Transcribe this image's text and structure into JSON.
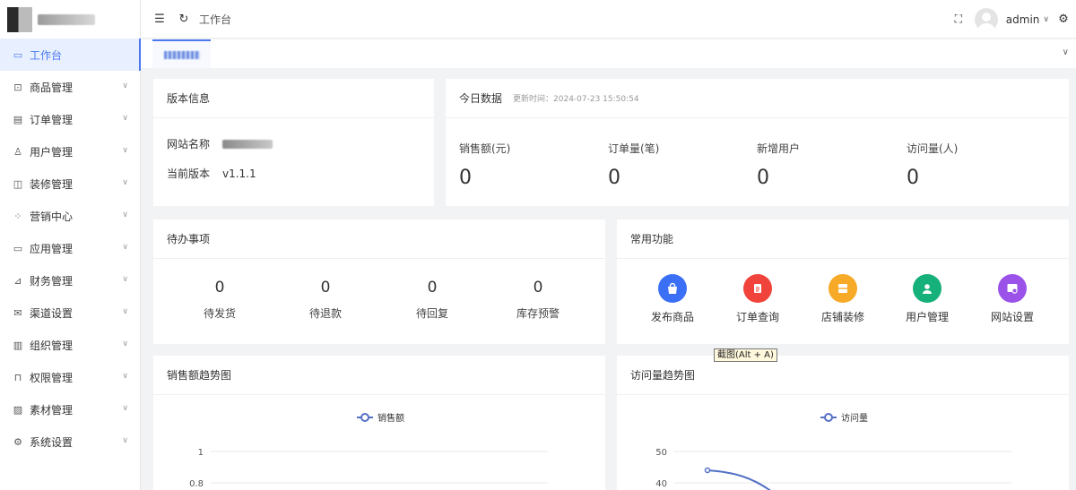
{
  "sidebar": {
    "items": [
      {
        "label": "工作台",
        "icon": "monitor-icon",
        "active": true
      },
      {
        "label": "商品管理",
        "icon": "shopping-bag-icon"
      },
      {
        "label": "订单管理",
        "icon": "document-icon"
      },
      {
        "label": "用户管理",
        "icon": "user-icon"
      },
      {
        "label": "装修管理",
        "icon": "palette-icon"
      },
      {
        "label": "营销中心",
        "icon": "apps-icon"
      },
      {
        "label": "应用管理",
        "icon": "card-icon"
      },
      {
        "label": "财务管理",
        "icon": "chart-icon"
      },
      {
        "label": "渠道设置",
        "icon": "mail-icon"
      },
      {
        "label": "组织管理",
        "icon": "building-icon"
      },
      {
        "label": "权限管理",
        "icon": "lock-icon"
      },
      {
        "label": "素材管理",
        "icon": "image-icon"
      },
      {
        "label": "系统设置",
        "icon": "gear-icon"
      }
    ]
  },
  "header": {
    "breadcrumb": "工作台",
    "username": "admin"
  },
  "version_card": {
    "title": "版本信息",
    "site_name_label": "网站名称",
    "version_label": "当前版本",
    "version_value": "v1.1.1"
  },
  "today_card": {
    "title": "今日数据",
    "updated": "更新时间：2024-07-23 15:50:54",
    "stats": [
      {
        "label": "销售额(元)",
        "value": "0"
      },
      {
        "label": "订单量(笔)",
        "value": "0"
      },
      {
        "label": "新增用户",
        "value": "0"
      },
      {
        "label": "访问量(人)",
        "value": "0"
      }
    ]
  },
  "todo_card": {
    "title": "待办事项",
    "items": [
      {
        "label": "待发货",
        "value": "0"
      },
      {
        "label": "待退款",
        "value": "0"
      },
      {
        "label": "待回复",
        "value": "0"
      },
      {
        "label": "库存预警",
        "value": "0"
      }
    ]
  },
  "functions_card": {
    "title": "常用功能",
    "items": [
      {
        "label": "发布商品",
        "color": "#3b6ff5",
        "icon": "bag-icon"
      },
      {
        "label": "订单查询",
        "color": "#f0433b",
        "icon": "clipboard-icon"
      },
      {
        "label": "店铺装修",
        "color": "#f7a928",
        "icon": "store-icon"
      },
      {
        "label": "用户管理",
        "color": "#16b07a",
        "icon": "user-icon"
      },
      {
        "label": "网站设置",
        "color": "#9b52e8",
        "icon": "browser-settings-icon"
      }
    ]
  },
  "tooltip": "截图(Alt + A)",
  "chart_data": [
    {
      "type": "line",
      "title": "销售额趋势图",
      "series": [
        {
          "name": "销售额",
          "values": []
        }
      ],
      "yticks": [
        "1",
        "0.8"
      ],
      "ylim": [
        0,
        1
      ]
    },
    {
      "type": "line",
      "title": "访问量趋势图",
      "series": [
        {
          "name": "访问量",
          "values": [
            44
          ]
        }
      ],
      "yticks": [
        "50",
        "40"
      ],
      "ylim": [
        0,
        50
      ]
    }
  ]
}
